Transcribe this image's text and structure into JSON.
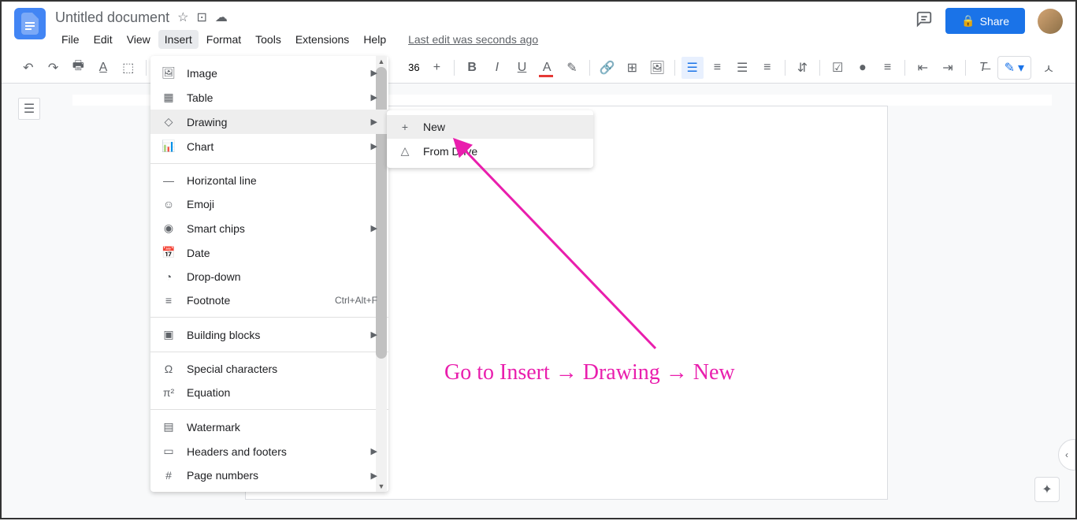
{
  "header": {
    "title": "Untitled document",
    "last_edit": "Last edit was seconds ago",
    "share_label": "Share"
  },
  "menubar": {
    "items": [
      "File",
      "Edit",
      "View",
      "Insert",
      "Format",
      "Tools",
      "Extensions",
      "Help"
    ],
    "active_index": 3
  },
  "toolbar": {
    "font_size": "36"
  },
  "insert_menu": {
    "items": [
      {
        "icon": "image",
        "label": "Image",
        "submenu": true
      },
      {
        "icon": "table",
        "label": "Table",
        "submenu": true
      },
      {
        "icon": "drawing",
        "label": "Drawing",
        "submenu": true,
        "highlighted": true
      },
      {
        "icon": "chart",
        "label": "Chart",
        "submenu": true
      },
      {
        "sep": true
      },
      {
        "icon": "hline",
        "label": "Horizontal line"
      },
      {
        "icon": "emoji",
        "label": "Emoji"
      },
      {
        "icon": "chips",
        "label": "Smart chips",
        "submenu": true
      },
      {
        "icon": "date",
        "label": "Date"
      },
      {
        "icon": "dropdown",
        "label": "Drop-down"
      },
      {
        "icon": "footnote",
        "label": "Footnote",
        "shortcut": "Ctrl+Alt+F"
      },
      {
        "sep": true
      },
      {
        "icon": "blocks",
        "label": "Building blocks",
        "submenu": true
      },
      {
        "sep": true
      },
      {
        "icon": "omega",
        "label": "Special characters"
      },
      {
        "icon": "equation",
        "label": "Equation"
      },
      {
        "sep": true
      },
      {
        "icon": "watermark",
        "label": "Watermark"
      },
      {
        "icon": "headers",
        "label": "Headers and footers",
        "submenu": true
      },
      {
        "icon": "pagenum",
        "label": "Page numbers",
        "submenu": true
      }
    ]
  },
  "drawing_submenu": {
    "items": [
      {
        "icon": "plus",
        "label": "New",
        "highlighted": true
      },
      {
        "icon": "drive",
        "label": "From Drive"
      }
    ]
  },
  "annotation": {
    "text": "Go to Insert → Drawing → New"
  }
}
